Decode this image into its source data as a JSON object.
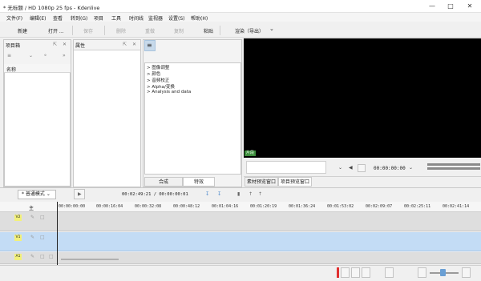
{
  "window": {
    "title": "* 无标题 / HD 1080p 25 fps - Kdenlive",
    "controls": [
      "minimize-icon",
      "maximize-icon",
      "close-icon"
    ]
  },
  "menu": [
    "文件(F)",
    "编辑(E)",
    "查看",
    "转到(G)",
    "项目",
    "工具",
    "时间线",
    "监视器",
    "设置(S)",
    "帮助(H)"
  ],
  "toolbar": {
    "new": "新建",
    "open": "打开 ...",
    "save": "保存",
    "delete": "删除",
    "redo": "重做",
    "copy": "复制",
    "paste": "粘贴",
    "render": "渲染（导出）",
    "record_color": "#d9383a"
  },
  "bin": {
    "title": "项目箱",
    "column_name": "名称"
  },
  "properties": {
    "title": "属性"
  },
  "effects": {
    "items": [
      "图像调整",
      "颜色",
      "音频校正",
      "Alpha/变换",
      "Analysis and data"
    ],
    "tab_composite": "合成",
    "tab_effects": "特效"
  },
  "monitor": {
    "badge": "片段",
    "timecode": "00:00:00:00",
    "tab_clip": "素材预览窗口",
    "tab_project": "项目预览窗口"
  },
  "timeline": {
    "mode": "普通模式",
    "position": "00:02:49:21 / 00:00:00:01",
    "master": "主",
    "ticks": [
      "00:00:00:00",
      "00:00:16:04",
      "00:00:32:08",
      "00:00:48:12",
      "00:01:04:16",
      "00:01:20:19",
      "00:01:36:24",
      "00:01:53:02",
      "00:02:09:07",
      "00:02:25:11",
      "00:02:41:14"
    ],
    "tracks": [
      {
        "label": "V2"
      },
      {
        "label": "V1"
      },
      {
        "label": "A1"
      }
    ]
  },
  "colors": {
    "accent": "#c3dcf5",
    "track_label": "#f2f07a",
    "playhead": "#e03030",
    "monitor_bg": "#000000",
    "monitor_badge": "#3c8c3c"
  }
}
